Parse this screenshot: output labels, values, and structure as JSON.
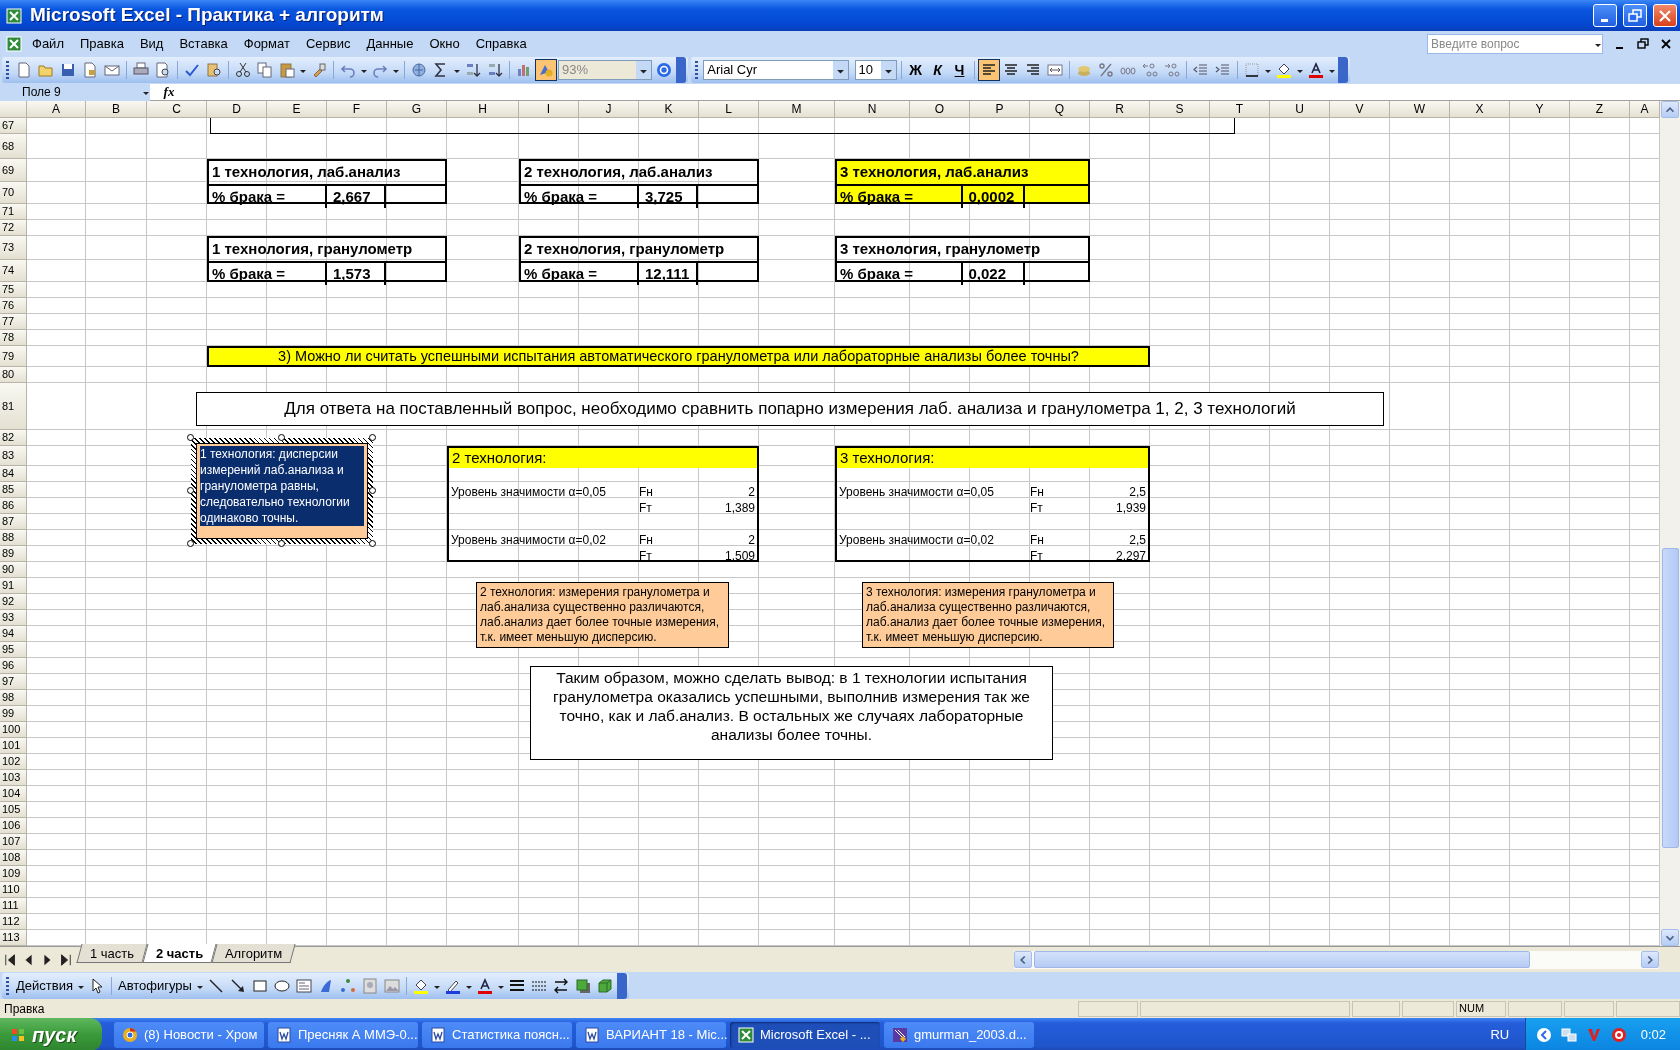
{
  "window": {
    "title": "Microsoft Excel - Практика + алгоритм"
  },
  "menu": {
    "items": [
      "Файл",
      "Правка",
      "Вид",
      "Вставка",
      "Формат",
      "Сервис",
      "Данные",
      "Окно",
      "Справка"
    ],
    "help_placeholder": "Введите вопрос"
  },
  "toolbar": {
    "zoom": "93%",
    "font": "Arial Cyr",
    "size": "10",
    "style_buttons": [
      "Ж",
      "К",
      "Ч"
    ],
    "alignments": [
      {
        "selected": true
      },
      {
        "selected": false
      },
      {
        "selected": false
      },
      {
        "selected": false
      }
    ]
  },
  "formula_bar": {
    "name_box": "Поле 9",
    "fx": "fx"
  },
  "columns": [
    "A",
    "B",
    "C",
    "D",
    "E",
    "F",
    "G",
    "H",
    "I",
    "J",
    "K",
    "L",
    "M",
    "N",
    "O",
    "P",
    "Q",
    "R",
    "S",
    "T",
    "U",
    "V",
    "W",
    "X",
    "Y",
    "Z",
    "A"
  ],
  "rows": [
    "67",
    "68",
    "69",
    "70",
    "71",
    "72",
    "73",
    "74",
    "75",
    "76",
    "77",
    "78",
    "79",
    "80",
    "81",
    "82",
    "83",
    "84",
    "85",
    "86",
    "87",
    "88",
    "89",
    "90",
    "91",
    "92",
    "93",
    "94",
    "95",
    "96",
    "97",
    "98",
    "99",
    "100",
    "101",
    "102",
    "103",
    "104",
    "105",
    "106",
    "107",
    "108",
    "109",
    "110",
    "111",
    "112",
    "113"
  ],
  "sheet": {
    "result_tables": [
      {
        "title": "1 технология, лаб.анализ",
        "label": "% брака =",
        "value": "2,667",
        "highlighted": false
      },
      {
        "title": "2 технология, лаб.анализ",
        "label": "% брака =",
        "value": "3,725",
        "highlighted": false
      },
      {
        "title": "3 технология, лаб.анализ",
        "label": "% брака =",
        "value": "0,0002",
        "highlighted": true
      },
      {
        "title": "1 технология, гранулометр",
        "label": "% брака =",
        "value": "1,573",
        "highlighted": false
      },
      {
        "title": "2 технология, гранулометр",
        "label": "% брака =",
        "value": "12,111",
        "highlighted": false
      },
      {
        "title": "3 технология, гранулометр",
        "label": "% брака =",
        "value": "0,022",
        "highlighted": false
      }
    ],
    "question": "3) Можно ли считать успешными испытания автоматического гранулометра или лабораторные анализы более точны?",
    "heading": "Для ответа на поставленный вопрос, необходимо сравнить попарно измерения лаб. анализа и гранулометра 1, 2, 3 технологий",
    "first_note": {
      "text": "1 технология: дисперсии измерений лаб.анализа и гранулометра равны, следовательно технологии одинаково точны.",
      "selected": true
    },
    "comparisons": [
      {
        "title": "2 технология:",
        "rows": [
          {
            "label": "Уровень значимости α=0,05",
            "name": "Fн",
            "value": "2"
          },
          {
            "name": "Fт",
            "value": "1,389"
          },
          {
            "label": "Уровень значимости α=0,02",
            "name": "Fн",
            "value": "2"
          },
          {
            "name": "Fт",
            "value": "1,509"
          }
        ],
        "note": "2 технология: измерения гранулометра и лаб.анализа существенно различаются, лаб.анализ дает более точные измерения, т.к. имеет меньшую дисперсию."
      },
      {
        "title": "3 технология:",
        "rows": [
          {
            "label": "Уровень значимости α=0,05",
            "name": "Fн",
            "value": "2,5"
          },
          {
            "name": "Fт",
            "value": "1,939"
          },
          {
            "label": "Уровень значимости α=0,02",
            "name": "Fн",
            "value": "2,5"
          },
          {
            "name": "Fт",
            "value": "2,297"
          }
        ],
        "note": "3 технология: измерения гранулометра и лаб.анализа существенно различаются, лаб.анализ дает более точные измерения, т.к. имеет меньшую дисперсию."
      }
    ],
    "conclusion": "Таким образом, можно сделать вывод: в 1 технологии испытания гранулометра оказались успешными, выполнив измерения так же точно, как и лаб.анализ. В остальных же случаях  лабораторные анализы более точны."
  },
  "sheet_tabs": [
    {
      "label": "1 часть",
      "selected": false
    },
    {
      "label": "2 часть",
      "selected": true
    },
    {
      "label": "Алгоритм",
      "selected": false
    }
  ],
  "drawing_toolbar": {
    "actions": "Действия",
    "autoshapes": "Автофигуры"
  },
  "status_bar": {
    "mode": "Правка",
    "indicator": "NUM"
  },
  "taskbar": {
    "start": "пуск",
    "tasks": [
      {
        "label": "(8) Новости - Хром",
        "selected": false
      },
      {
        "label": "Пресняк А ММЭ-0...",
        "selected": false
      },
      {
        "label": "Статистика поясн...",
        "selected": false
      },
      {
        "label": "ВАРИАНТ 18 - Mic...",
        "selected": false
      },
      {
        "label": "Microsoft Excel - ...",
        "selected": true
      },
      {
        "label": "gmurman_2003.d...",
        "selected": false
      }
    ],
    "language": "RU",
    "clock": "0:02"
  }
}
